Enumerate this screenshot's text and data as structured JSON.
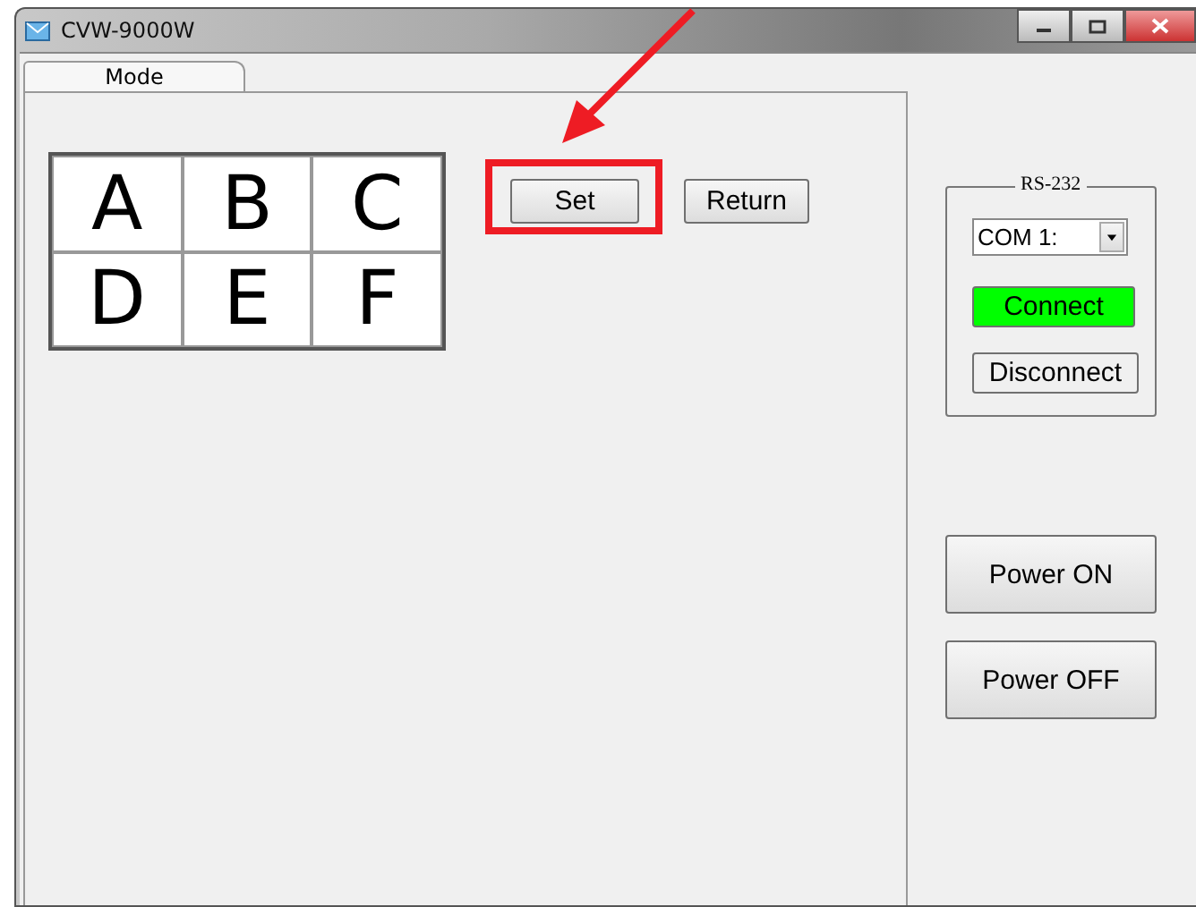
{
  "window": {
    "title": "CVW-9000W"
  },
  "tabs": [
    {
      "label": "Mode",
      "selected": true
    }
  ],
  "layout_grid": {
    "cells": [
      "A",
      "B",
      "C",
      "D",
      "E",
      "F"
    ]
  },
  "mode_buttons": [
    {
      "label": "Set"
    },
    {
      "label": "Return"
    }
  ],
  "rs232": {
    "title": "RS-232",
    "port": {
      "value": "COM 1:"
    },
    "buttons": [
      {
        "label": "Connect",
        "color": "#00ff00"
      },
      {
        "label": "Disconnect",
        "color": "#f0f0f0"
      }
    ]
  },
  "power_buttons": [
    {
      "label": "Power ON"
    },
    {
      "label": "Power OFF"
    }
  ],
  "annotations": {
    "arrow": true,
    "highlight_frame": true
  }
}
